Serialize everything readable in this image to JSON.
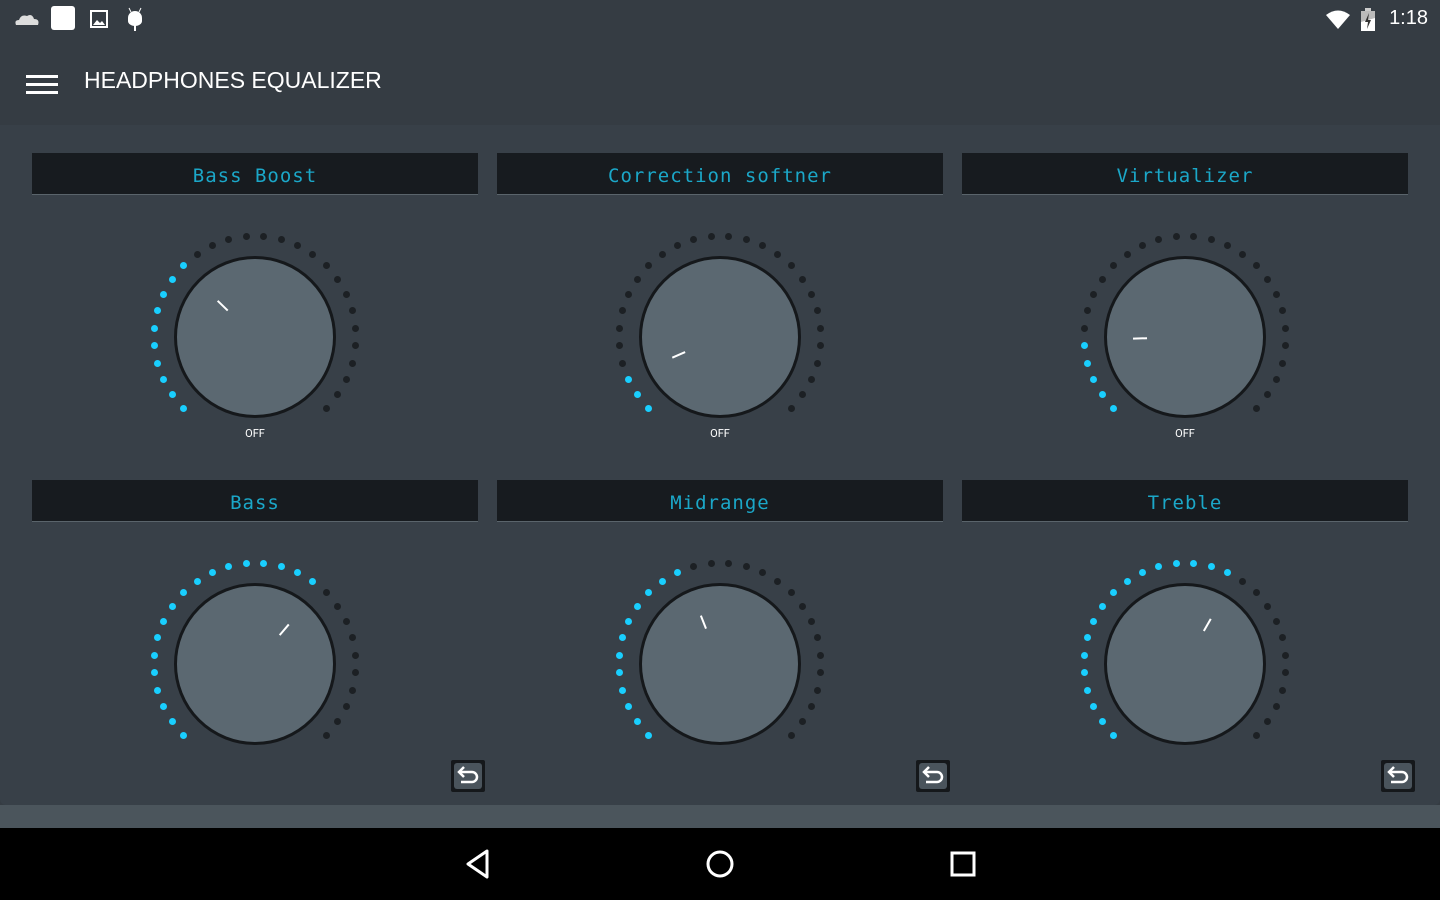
{
  "status_bar": {
    "time": "1:18",
    "icons": [
      "cloud-icon",
      "square-notification-icon",
      "image-icon",
      "android-icon",
      "wifi-icon",
      "battery-charging-icon"
    ]
  },
  "app_bar": {
    "title": "HEADPHONES EQUALIZER"
  },
  "controls": [
    {
      "label": "Bass Boost",
      "state": "OFF",
      "level": 0.33,
      "lit_dots": 10
    },
    {
      "label": "Correction softner",
      "state": "OFF",
      "level": 0.08,
      "lit_dots": 3
    },
    {
      "label": "Virtualizer",
      "state": "OFF",
      "level": 0.16,
      "lit_dots": 5
    },
    {
      "label": "Bass",
      "state": "",
      "level": 0.65,
      "lit_dots": 18
    },
    {
      "label": "Midrange",
      "state": "",
      "level": 0.42,
      "lit_dots": 12
    },
    {
      "label": "Treble",
      "state": "",
      "level": 0.61,
      "lit_dots": 17
    }
  ],
  "colors": {
    "accent": "#19cfff",
    "label_text": "#1ba7c8",
    "background": "#384048"
  }
}
